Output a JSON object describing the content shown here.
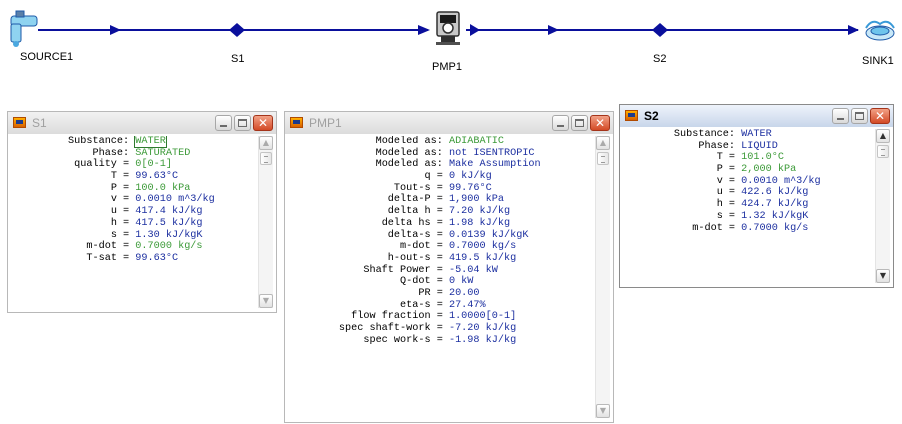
{
  "diagram": {
    "nodes": [
      {
        "id": "source1",
        "label": "SOURCE1"
      },
      {
        "id": "s1",
        "label": "S1"
      },
      {
        "id": "pmp1",
        "label": "PMP1"
      },
      {
        "id": "s2",
        "label": "S2"
      },
      {
        "id": "sink1",
        "label": "SINK1"
      }
    ]
  },
  "windows": {
    "s1": {
      "title": "S1",
      "properties": [
        {
          "label": "Substance:",
          "value": "WATER",
          "style": "fixed boxed"
        },
        {
          "label": "Phase:",
          "value": "SATURATED",
          "style": "fixed"
        },
        {
          "label": "quality =",
          "value": "0[0-1]",
          "style": "fixed"
        },
        {
          "label": "T =",
          "value": "99.63°C",
          "style": ""
        },
        {
          "label": "P =",
          "value": "100.0 kPa",
          "style": "fixed"
        },
        {
          "label": "v =",
          "value": "0.0010 m^3/kg",
          "style": ""
        },
        {
          "label": "u =",
          "value": "417.4 kJ/kg",
          "style": ""
        },
        {
          "label": "h =",
          "value": "417.5 kJ/kg",
          "style": ""
        },
        {
          "label": "s =",
          "value": "1.30 kJ/kgK",
          "style": ""
        },
        {
          "label": "m-dot =",
          "value": "0.7000 kg/s",
          "style": "fixed"
        },
        {
          "label": "T-sat =",
          "value": "99.63°C",
          "style": ""
        }
      ]
    },
    "pmp1": {
      "title": "PMP1",
      "properties": [
        {
          "label": "Modeled as:",
          "value": "ADIABATIC",
          "style": "fixed"
        },
        {
          "label": "Modeled as:",
          "value": "not ISENTROPIC",
          "style": ""
        },
        {
          "label": "Modeled as:",
          "value": "Make Assumption",
          "style": ""
        },
        {
          "label": "q =",
          "value": "0 kJ/kg",
          "style": ""
        },
        {
          "label": "Tout-s =",
          "value": "99.76°C",
          "style": ""
        },
        {
          "label": "delta-P =",
          "value": "1,900 kPa",
          "style": ""
        },
        {
          "label": "delta h =",
          "value": "7.20 kJ/kg",
          "style": ""
        },
        {
          "label": "delta hs =",
          "value": "1.98 kJ/kg",
          "style": ""
        },
        {
          "label": "delta-s =",
          "value": "0.0139 kJ/kgK",
          "style": ""
        },
        {
          "label": "m-dot =",
          "value": "0.7000 kg/s",
          "style": ""
        },
        {
          "label": "h-out-s =",
          "value": "419.5 kJ/kg",
          "style": ""
        },
        {
          "label": "Shaft Power =",
          "value": "-5.04 kW",
          "style": ""
        },
        {
          "label": "Q-dot =",
          "value": "0 kW",
          "style": ""
        },
        {
          "label": "PR =",
          "value": "20.00",
          "style": ""
        },
        {
          "label": "eta-s =",
          "value": "27.47%",
          "style": ""
        },
        {
          "label": "flow fraction =",
          "value": "1.0000[0-1]",
          "style": ""
        },
        {
          "label": "spec shaft-work =",
          "value": "-7.20 kJ/kg",
          "style": ""
        },
        {
          "label": "spec work-s =",
          "value": "-1.98 kJ/kg",
          "style": ""
        }
      ]
    },
    "s2": {
      "title": "S2",
      "properties": [
        {
          "label": "Substance:",
          "value": "WATER",
          "style": ""
        },
        {
          "label": "Phase:",
          "value": "LIQUID",
          "style": ""
        },
        {
          "label": "T =",
          "value": "101.0°C",
          "style": "fixed"
        },
        {
          "label": "P =",
          "value": "2,000 kPa",
          "style": "fixed"
        },
        {
          "label": "v =",
          "value": "0.0010 m^3/kg",
          "style": ""
        },
        {
          "label": "u =",
          "value": "422.6 kJ/kg",
          "style": ""
        },
        {
          "label": "h =",
          "value": "424.7 kJ/kg",
          "style": ""
        },
        {
          "label": "s =",
          "value": "1.32 kJ/kgK",
          "style": ""
        },
        {
          "label": "m-dot =",
          "value": "0.7000 kg/s",
          "style": ""
        }
      ]
    }
  },
  "colors": {
    "flow_line": "#0a0f9c",
    "calculated_value": "#1c2fa0",
    "input_value": "#3c9a38"
  }
}
